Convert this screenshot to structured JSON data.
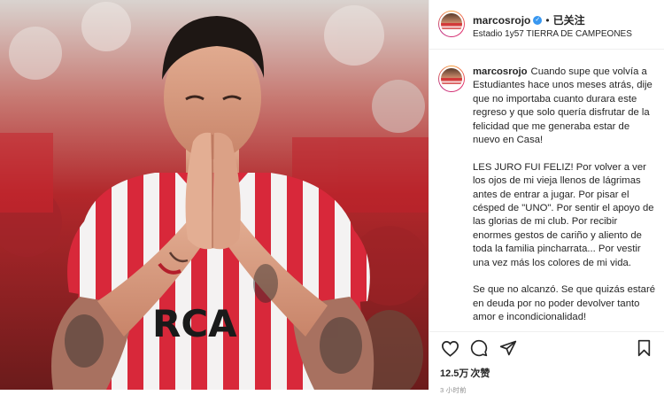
{
  "post": {
    "media": {
      "alt": "Photo of player praying hands in red-white striped jersey"
    },
    "header": {
      "username": "marcosrojo",
      "verified_icon": "verified-badge-icon",
      "separator": "•",
      "follow_status": "已关注",
      "location": "Estadio 1y57 TIERRA DE CAMPEONES"
    },
    "caption": {
      "username": "marcosrojo",
      "paragraphs": [
        "Cuando supe que volvía a Estudiantes hace unos meses atrás, dije que no importaba cuanto durara este regreso y que solo quería disfrutar de la felicidad que me generaba estar de nuevo en Casa!",
        "LES JURO FUI FELIZ! Por volver a ver los ojos de mi vieja llenos de lágrimas antes de entrar a jugar. Por pisar el césped de \"UNO\". Por sentir el apoyo de las glorias de mi club. Por recibir enormes gestos de cariño y aliento de toda la familia pincharrata... Por vestir una vez más los colores de mi vida.",
        "Se que no alcanzó. Se que quizás estaré en deuda por no poder devolver tanto amor e incondicionalidad!"
      ]
    },
    "actions": {
      "icons": [
        "heart-icon",
        "comment-icon",
        "share-icon",
        "bookmark-icon"
      ],
      "likes_count": "12.5万",
      "likes_label": "次赞",
      "timestamp": "3 小时前"
    },
    "colors": {
      "verified": "#3897f0",
      "text": "#262626",
      "muted": "#8e8e8e",
      "jersey_red": "#d8283a"
    }
  }
}
